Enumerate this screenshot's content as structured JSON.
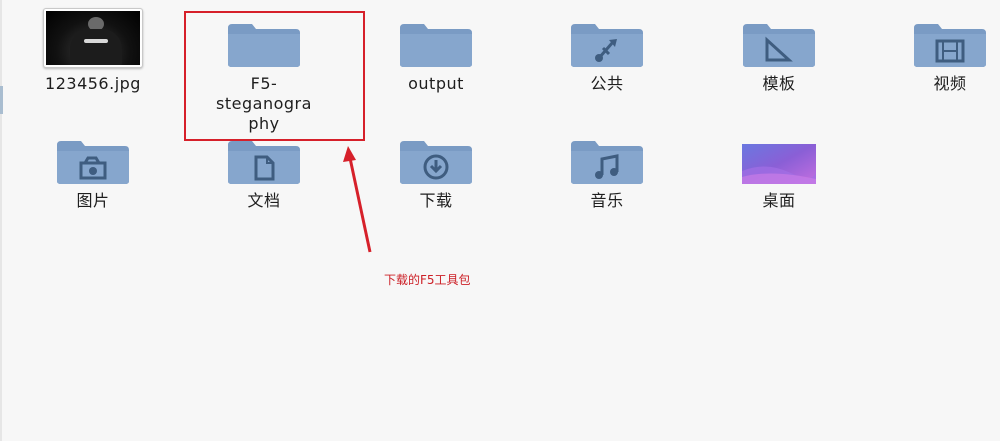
{
  "items": [
    {
      "label": "123456.jpg",
      "kind": "image"
    },
    {
      "label": "F5-\nsteganogra\nphy",
      "kind": "folder",
      "emblem": "none"
    },
    {
      "label": "output",
      "kind": "folder",
      "emblem": "none"
    },
    {
      "label": "公共",
      "kind": "folder",
      "emblem": "share-icon"
    },
    {
      "label": "模板",
      "kind": "folder",
      "emblem": "template-icon"
    },
    {
      "label": "视频",
      "kind": "folder",
      "emblem": "film-icon"
    },
    {
      "label": "图片",
      "kind": "folder",
      "emblem": "camera-icon"
    },
    {
      "label": "文档",
      "kind": "folder",
      "emblem": "document-icon"
    },
    {
      "label": "下载",
      "kind": "folder",
      "emblem": "download-icon"
    },
    {
      "label": "音乐",
      "kind": "folder",
      "emblem": "music-icon"
    },
    {
      "label": "桌面",
      "kind": "desktop-folder",
      "emblem": "none"
    }
  ],
  "annotation": {
    "text": "下载的F5工具包",
    "color": "#cc1f26"
  },
  "colors": {
    "folder": "#7a9bc4",
    "folder_dark": "#5f80aa",
    "emblem": "#3f5d80",
    "highlight": "#d6202a"
  }
}
